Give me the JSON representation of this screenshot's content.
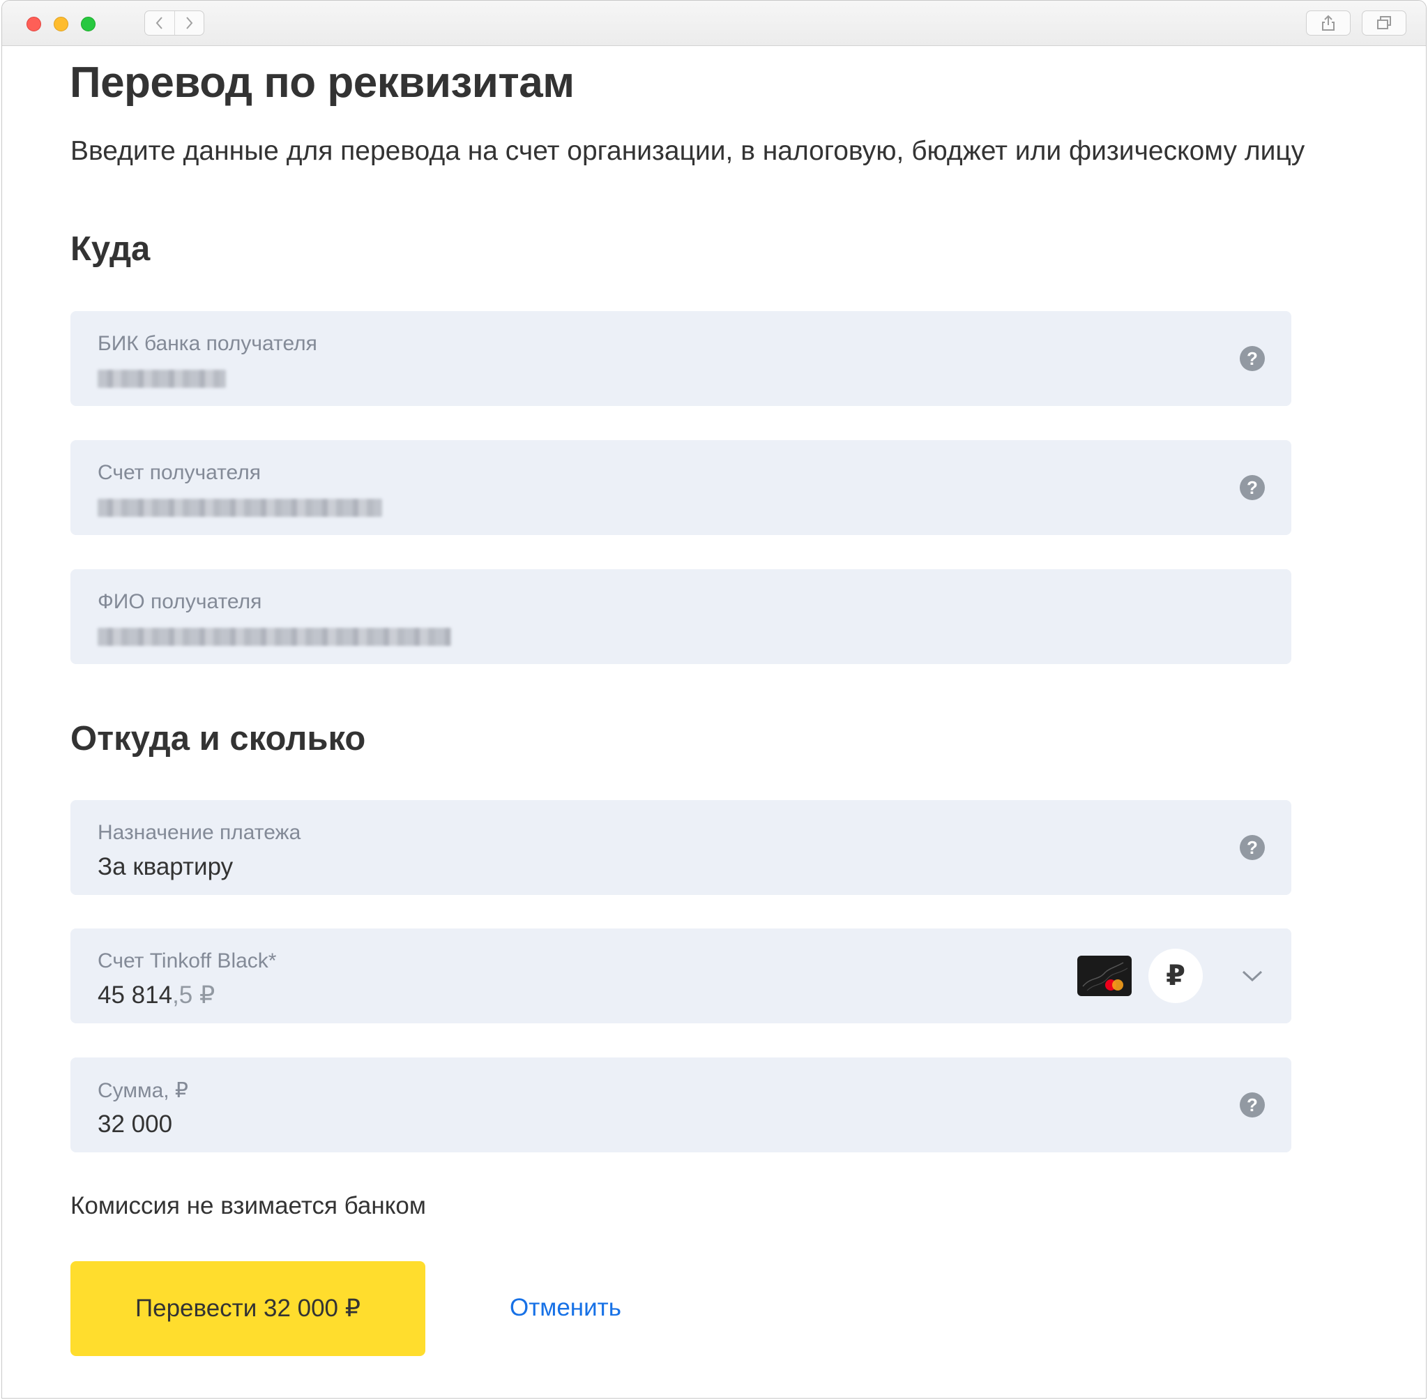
{
  "window": {
    "controls": [
      "close",
      "minimize",
      "zoom"
    ],
    "toolbar_icons": [
      "back-icon",
      "forward-icon",
      "share-icon",
      "tabs-icon"
    ]
  },
  "page": {
    "title": "Перевод по реквизитам",
    "subtitle": "Введите данные для перевода на счет организации, в налоговую, бюджет или физическому лицу"
  },
  "section_to": {
    "heading": "Куда",
    "fields": [
      {
        "label": "БИК банка получателя",
        "value_state": "blurred",
        "help_icon": "question-icon"
      },
      {
        "label": "Счет получателя",
        "value_state": "blurred",
        "help_icon": "question-icon"
      },
      {
        "label": "ФИО получателя",
        "value_state": "blurred"
      }
    ]
  },
  "section_from": {
    "heading": "Откуда и сколько",
    "purpose": {
      "label": "Назначение платежа",
      "value": "За квартиру",
      "help_icon": "question-icon"
    },
    "account": {
      "label": "Счет Tinkoff Black*",
      "value_main": "45 814",
      "value_fraction": ",5 ₽",
      "currency_symbol": "₽",
      "icons": [
        "card-icon",
        "ruble-icon",
        "chevron-down-icon"
      ]
    },
    "amount": {
      "label": "Сумма, ₽",
      "value": "32 000",
      "help_icon": "question-icon"
    }
  },
  "footer": {
    "commission_note": "Комиссия не взимается банком",
    "submit_label": "Перевести 32 000 ₽",
    "cancel_label": "Отменить"
  },
  "colors": {
    "accent_button": "#ffdd2d",
    "link": "#1771e6",
    "field_bg": "#ecf0f7",
    "label": "#838a97"
  }
}
